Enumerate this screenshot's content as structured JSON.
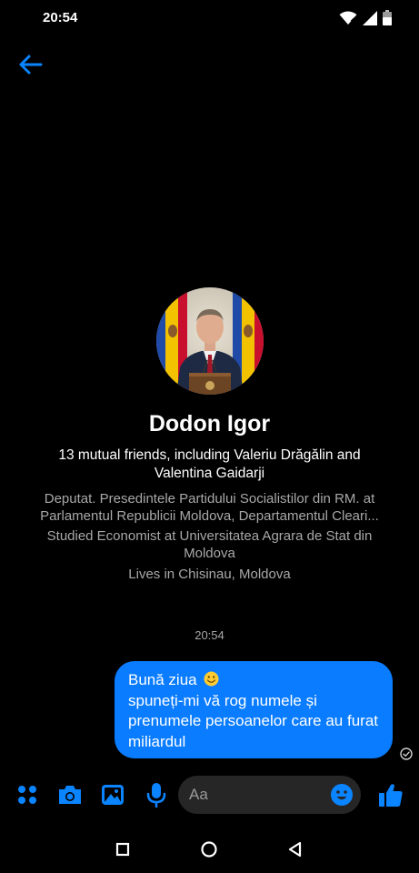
{
  "status_bar": {
    "time": "20:54",
    "icons": [
      "wifi-icon",
      "cell-signal-icon",
      "battery-icon"
    ]
  },
  "header": {
    "back_icon": "arrow-left-icon"
  },
  "profile": {
    "name": "Dodon Igor",
    "mutual_friends": "13 mutual friends, including Valeriu Drăgălin and Valentina Gaidarji",
    "work_line1": "Deputat. Presedintele Partidului Socialistilor din RM. at",
    "work_line2": "Parlamentul Republicii Moldova, Departamentul Cleari...",
    "education": "Studied Economist at Universitatea Agrara de Stat din Moldova",
    "location": "Lives in Chisinau, Moldova"
  },
  "conversation": {
    "timestamp": "20:54",
    "messages": [
      {
        "line1": "Bună ziua",
        "line2": "spuneți-mi vă rog numele și prenumele persoanelor care au furat miliardul",
        "status": "sent"
      }
    ]
  },
  "composer": {
    "placeholder": "Aa",
    "icons": [
      "apps-dots-icon",
      "camera-icon",
      "gallery-icon",
      "microphone-icon",
      "emoji-icon",
      "thumbs-up-icon"
    ]
  },
  "colors": {
    "accent": "#0a84ff",
    "bubble": "#0a7cff",
    "background": "#000000",
    "input_bg": "#262626",
    "secondary_text": "#a8a8a8"
  },
  "navbar": {
    "icons": [
      "recents-square-icon",
      "home-circle-icon",
      "back-triangle-icon"
    ]
  }
}
